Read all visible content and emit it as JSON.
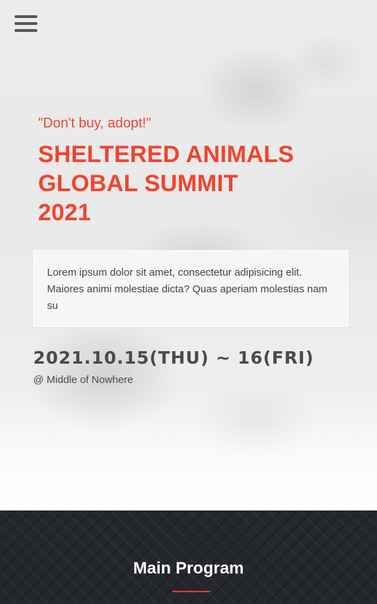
{
  "header": {
    "menu_icon": "hamburger-menu-icon"
  },
  "hero": {
    "slogan": "\"Don't buy, adopt!\"",
    "title": "SHELTERED ANIMALS\nGLOBAL SUMMIT\n2021",
    "intro": "Lorem ipsum dolor sit amet, consectetur adipisicing elit. Maiores animi molestiae dicta? Quas aperiam molestias nam su",
    "date": "2021.10.15(THU) ~ 16(FRI)",
    "location": "@ Middle of Nowhere"
  },
  "program": {
    "title": "Main Program"
  },
  "colors": {
    "accent": "#f1442e",
    "dark_section": "#25272e",
    "text": "#4a4a4a"
  }
}
